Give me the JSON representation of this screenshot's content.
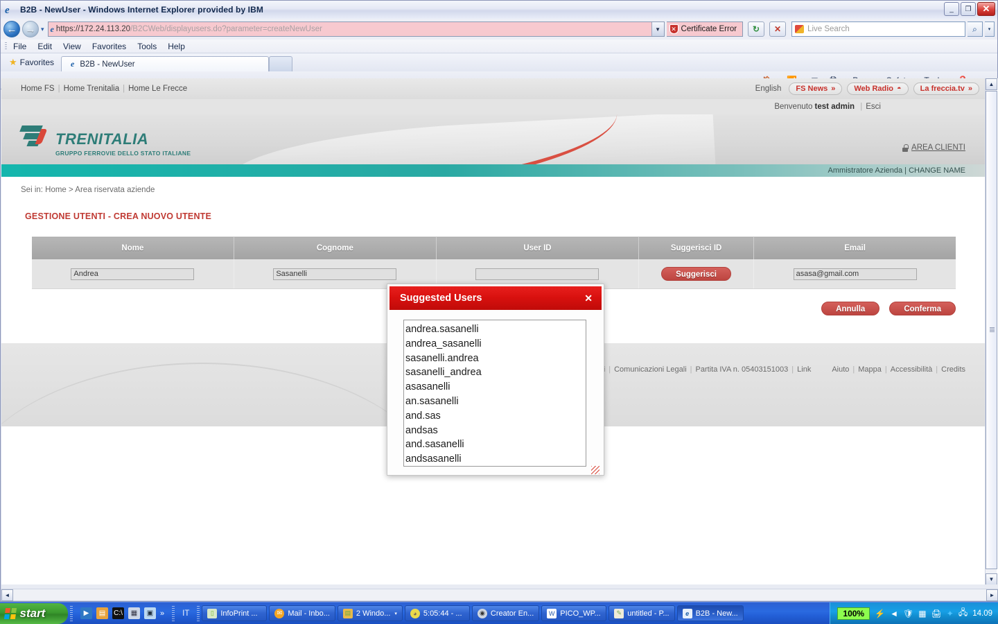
{
  "browser": {
    "title": "B2B - NewUser - Windows Internet Explorer provided by IBM",
    "window_buttons": {
      "minimize": "_",
      "maximize": "❐",
      "close": "✕"
    },
    "nav": {
      "back": "←",
      "forward": "→",
      "history_caret": "▾"
    },
    "address": {
      "url_host": "https://172.24.113.20",
      "url_path": "/B2CWeb/displayusers.do?parameter=createNewUser",
      "dropdown": "▼"
    },
    "certificate_error": "Certificate Error",
    "refresh_label": "↻",
    "stop_label": "✕",
    "search": {
      "placeholder": "Live Search",
      "go": "🔍",
      "go_dropdown": "▾"
    },
    "menu": [
      "File",
      "Edit",
      "View",
      "Favorites",
      "Tools",
      "Help"
    ],
    "favorites_label": "Favorites",
    "tabs": [
      {
        "label": "B2B - NewUser"
      }
    ],
    "new_tab_label": "",
    "command_bar": [
      {
        "name": "home",
        "label": "",
        "caret": "▾"
      },
      {
        "name": "feeds",
        "label": "",
        "caret": "▾"
      },
      {
        "name": "mail",
        "label": "",
        "caret": ""
      },
      {
        "name": "print",
        "label": "",
        "caret": "▾"
      },
      {
        "name": "page",
        "label": "Page",
        "caret": "▾"
      },
      {
        "name": "safety",
        "label": "Safety",
        "caret": "▾"
      },
      {
        "name": "tools",
        "label": "Tools",
        "caret": "▾"
      },
      {
        "name": "help",
        "label": "",
        "caret": "▾"
      }
    ],
    "command_overflow": "»"
  },
  "page": {
    "top_links": [
      "Home FS",
      "Home Trenitalia",
      "Home Le Frecce"
    ],
    "separator": "|",
    "language": "English",
    "promo_buttons": [
      {
        "label": "FS News",
        "glyph": "»"
      },
      {
        "label": "Web Radio",
        "glyph": "◓"
      },
      {
        "label": "La freccia.tv",
        "glyph": "»"
      }
    ],
    "welcome_prefix": "Benvenuto",
    "welcome_user": "test admin",
    "welcome_logout": "Esci",
    "logo": {
      "name": "TRENITALIA",
      "subtitle": "GRUPPO FERROVIE DELLO STATO ITALIANE"
    },
    "area_clienti": "AREA CLIENTI",
    "teal_bar": "Ammistratore Azienda | CHANGE NAME",
    "breadcrumb": "Sei in: Home  >  Area riservata aziende",
    "page_title": "GESTIONE UTENTI - CREA NUOVO UTENTE",
    "table": {
      "headers": [
        "Nome",
        "Cognome",
        "User ID",
        "Suggerisci ID",
        "Email"
      ],
      "row": {
        "nome": "Andrea",
        "cognome": "Sasanelli",
        "user_id": "",
        "suggerisci_button": "Suggerisci",
        "email": "asasa@gmail.com"
      }
    },
    "buttons": {
      "cancel": "Annulla",
      "confirm": "Conferma"
    },
    "footer_links": [
      "tti",
      "Comunicazioni Legali",
      "Partita IVA n. 05403151003",
      "Link"
    ],
    "footer_links_right": [
      "Aiuto",
      "Mappa",
      "Accessibilità",
      "Credits"
    ]
  },
  "dialog": {
    "title": "Suggested Users",
    "close_label": "✕",
    "items": [
      "andrea.sasanelli",
      "andrea_sasanelli",
      "sasanelli.andrea",
      "sasanelli_andrea",
      "asasanelli",
      "an.sasanelli",
      "and.sas",
      "andsas",
      "and.sasanelli",
      "andsasanelli"
    ]
  },
  "taskbar": {
    "start_label": "start",
    "quick_launch": [
      "media-icon",
      "folder-icon",
      "console-icon",
      "notes-icon",
      "doc-icon"
    ],
    "quick_overflow": "»",
    "language_indicator": "IT",
    "items": [
      {
        "label": "InfoPrint ...",
        "icon": "printer-icon",
        "active": false
      },
      {
        "label": "Mail - Inbo...",
        "icon": "mail-icon",
        "active": false
      },
      {
        "label": "2 Windo...",
        "icon": "folder-icon",
        "active": false,
        "caret": "▾"
      },
      {
        "label": "5:05:44  - ...",
        "icon": "timer-icon",
        "active": false
      },
      {
        "label": "Creator En...",
        "icon": "disc-icon",
        "active": false
      },
      {
        "label": "PICO_WP...",
        "icon": "word-icon",
        "active": false
      },
      {
        "label": "untitled - P...",
        "icon": "paint-icon",
        "active": false
      },
      {
        "label": "B2B - New...",
        "icon": "ie-icon",
        "active": true
      }
    ],
    "battery": "100%",
    "tray_icons": [
      "power-icon",
      "action-center-icon",
      "security-icon",
      "network-icon",
      "printer-icon",
      "bluetooth-icon",
      "lan-icon"
    ],
    "clock": "14.09"
  },
  "colors": {
    "accent_red": "#c8312b",
    "dialog_red": "#d9110f",
    "teal": "#14b6ad",
    "brand_teal": "#2e7d78"
  }
}
